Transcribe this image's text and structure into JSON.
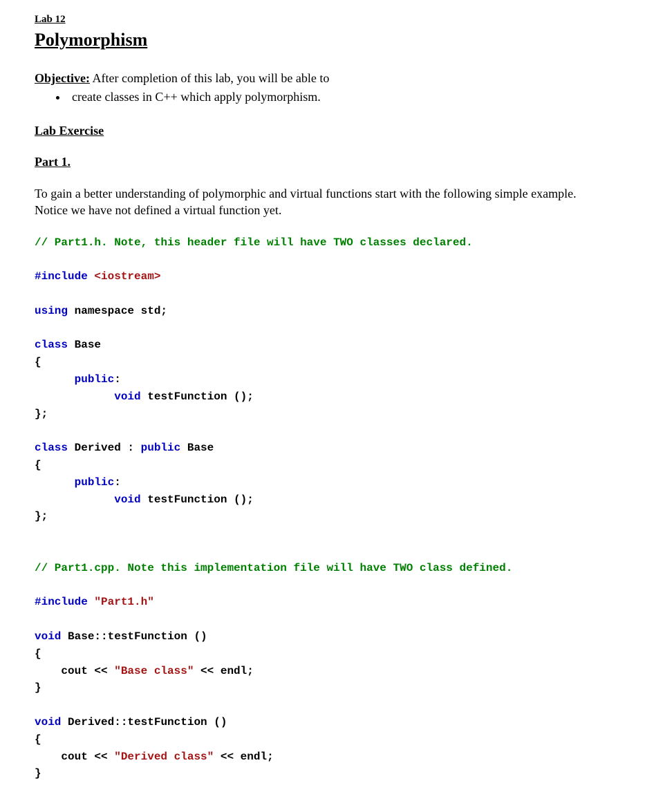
{
  "labNumber": "Lab 12",
  "title": "Polymorphism",
  "objective": {
    "label": "Objective:",
    "intro": " After completion of this lab, you will be able to",
    "bullets": [
      "create classes in C++ which apply polymorphism."
    ]
  },
  "labExerciseHeading": "Lab Exercise",
  "part1": {
    "heading": "Part 1.",
    "paragraph": "To gain a better understanding of polymorphic and virtual functions start with the following simple example. Notice we have not defined a virtual function yet."
  },
  "code": {
    "c1": "// Part1.h. Note, this header file will have TWO classes declared.",
    "bl1": "",
    "inc": "#include ",
    "incHdr": "<iostream>",
    "bl2": "",
    "kwUsing": "using ",
    "nsp": "namespace std;",
    "bl3": "",
    "kwClass1": "class ",
    "clsBase": "Base",
    "ob1": "{",
    "indent1": "      ",
    "kwPublic1": "public",
    "colon1": ":",
    "indent2": "            ",
    "kwVoid1": "void ",
    "fn1": "testFunction ();",
    "cb1": "};",
    "bl4": "",
    "kwClass2": "class ",
    "clsDerived": "Derived : ",
    "kwPublic2": "public ",
    "baseRef": "Base",
    "ob2": "{",
    "kwPublic3": "public",
    "colon3": ":",
    "kwVoid2": "void ",
    "fn2": "testFunction ();",
    "cb2": "};",
    "bl5": "",
    "bl5b": "",
    "c2": "// Part1.cpp. Note this implementation file will have TWO class defined.",
    "bl6": "",
    "inc2": "#include ",
    "incHdr2": "\"Part1.h\"",
    "bl7": "",
    "kwVoid3": "void ",
    "defBase": "Base::testFunction ()",
    "ob3": "{",
    "indentCout": "    ",
    "coutA1": "cout << ",
    "strBase": "\"Base class\"",
    "coutA2": " << endl;",
    "cb3": "}",
    "bl8": "",
    "kwVoid4": "void ",
    "defDerived": "Derived::testFunction ()",
    "ob4": "{",
    "coutB1": "cout << ",
    "strDerived": "\"Derived class\"",
    "coutB2": " << endl;",
    "cb4": "}"
  }
}
